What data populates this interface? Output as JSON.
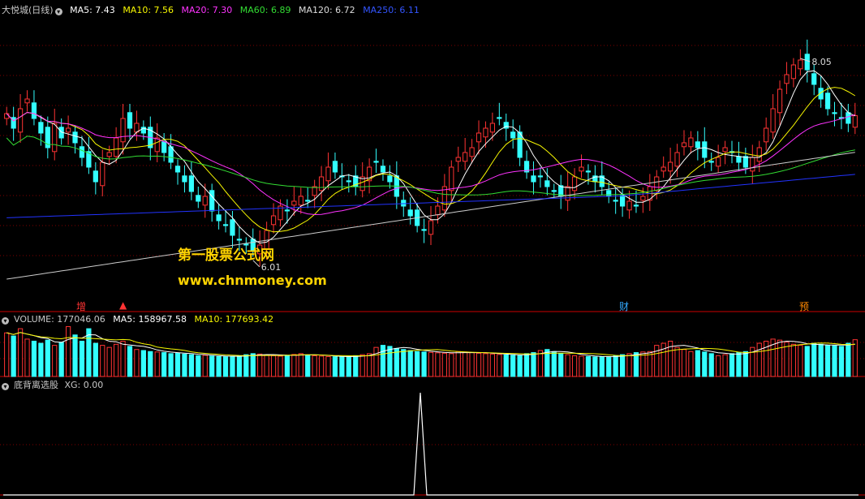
{
  "colors": {
    "ma5": "#ffffff",
    "ma10": "#f7f700",
    "ma20": "#ff33ff",
    "ma60": "#33dd33",
    "ma120": "#cccccc",
    "ma250": "#2233ff",
    "up": "#ff3333",
    "down": "#33ffff",
    "grid": "#800000"
  },
  "price_panel": {
    "name": "大悦城(日线)",
    "ma5": "MA5: 7.43",
    "ma10": "MA10: 7.56",
    "ma20": "MA20: 7.30",
    "ma60": "MA60: 6.89",
    "ma120": "MA120: 6.72",
    "ma250": "MA250: 6.11",
    "high_label": "8.05",
    "low_label": "6.01",
    "events": [
      {
        "label": "增",
        "color": "#ff3333"
      },
      {
        "label": "▲",
        "color": "#ff3333"
      },
      {
        "label": "财",
        "color": "#33aaff"
      },
      {
        "label": "预",
        "color": "#ff8800"
      }
    ]
  },
  "volume_panel": {
    "title": "VOLUME: 177046.06",
    "ma5": "MA5: 158967.58",
    "ma10": "MA10: 177693.42"
  },
  "indicator_panel": {
    "title": "底背离选股",
    "xg": "XG: 0.00"
  },
  "watermark": {
    "line1": "第一股票公式网",
    "line2": "www.chnmoney.com"
  },
  "chart_data": {
    "type": "candlestick",
    "high": 8.05,
    "low": 6.01,
    "closes": [
      7.45,
      7.3,
      7.5,
      7.6,
      7.4,
      7.25,
      7.1,
      7.35,
      7.2,
      7.3,
      7.15,
      7.0,
      6.9,
      6.75,
      6.95,
      7.05,
      7.2,
      7.4,
      7.3,
      7.35,
      7.25,
      7.1,
      7.2,
      7.05,
      6.95,
      6.85,
      6.75,
      6.65,
      6.55,
      6.6,
      6.45,
      6.35,
      6.3,
      6.2,
      6.15,
      6.1,
      6.05,
      6.1,
      6.25,
      6.4,
      6.5,
      6.45,
      6.55,
      6.6,
      6.55,
      6.7,
      6.8,
      6.9,
      6.85,
      6.8,
      6.75,
      6.7,
      6.8,
      6.9,
      6.95,
      6.85,
      6.75,
      6.6,
      6.5,
      6.4,
      6.3,
      6.25,
      6.35,
      6.5,
      6.7,
      6.9,
      7.0,
      7.05,
      7.1,
      7.25,
      7.3,
      7.35,
      7.4,
      7.3,
      7.2,
      7.0,
      6.85,
      6.75,
      6.8,
      6.7,
      6.65,
      6.6,
      6.7,
      6.8,
      6.9,
      6.85,
      6.75,
      6.7,
      6.6,
      6.55,
      6.5,
      6.55,
      6.5,
      6.6,
      6.7,
      6.8,
      6.9,
      6.95,
      7.05,
      7.15,
      7.2,
      7.1,
      7.0,
      6.95,
      7.0,
      7.1,
      7.05,
      6.95,
      6.9,
      7.0,
      7.1,
      7.3,
      7.5,
      7.7,
      7.85,
      7.95,
      8.0,
      7.9,
      7.75,
      7.6,
      7.5,
      7.45,
      7.4,
      7.35,
      7.43
    ],
    "volumes": [
      210000,
      195000,
      230000,
      180000,
      170000,
      160000,
      175000,
      150000,
      165000,
      240000,
      200000,
      170000,
      230000,
      160000,
      150000,
      140000,
      155000,
      170000,
      145000,
      130000,
      125000,
      120000,
      118000,
      115000,
      110000,
      112000,
      108000,
      105000,
      100000,
      102000,
      98000,
      96000,
      95000,
      97000,
      100000,
      105000,
      110000,
      108000,
      104000,
      100000,
      98000,
      102000,
      106000,
      110000,
      104000,
      100000,
      98000,
      96000,
      95000,
      94000,
      96000,
      100000,
      105000,
      110000,
      140000,
      150000,
      145000,
      135000,
      130000,
      125000,
      120000,
      118000,
      116000,
      114000,
      112000,
      110000,
      120000,
      118000,
      115000,
      112000,
      110000,
      108000,
      106000,
      104000,
      102000,
      100000,
      110000,
      115000,
      125000,
      130000,
      120000,
      110000,
      105000,
      100000,
      98000,
      96000,
      94000,
      95000,
      96000,
      100000,
      105000,
      110000,
      115000,
      118000,
      120000,
      150000,
      160000,
      170000,
      140000,
      130000,
      120000,
      125000,
      118000,
      110000,
      100000,
      105000,
      110000,
      115000,
      120000,
      140000,
      160000,
      170000,
      180000,
      175000,
      165000,
      155000,
      150000,
      145000,
      160000,
      155000,
      150000,
      148000,
      145000,
      160000,
      177046
    ]
  }
}
